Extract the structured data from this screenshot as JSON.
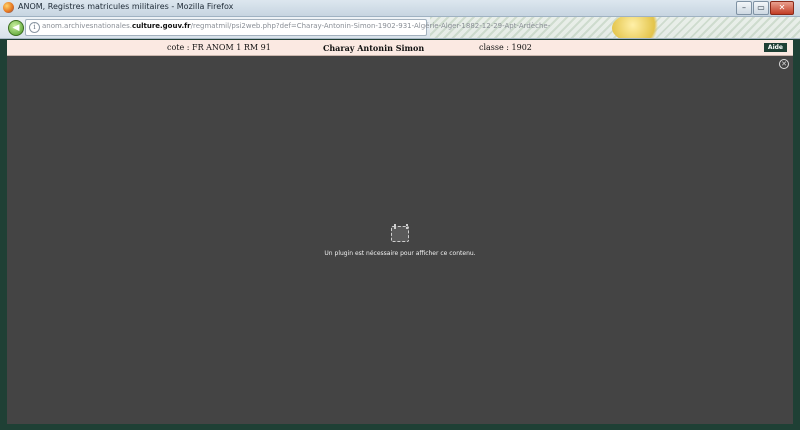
{
  "window": {
    "title": "ANOM, Registres matricules militaires - Mozilla Firefox",
    "controls": {
      "minimize": "–",
      "maximize": "▭",
      "close": "✕"
    }
  },
  "navbar": {
    "back_icon": "back-arrow-icon",
    "url_prefix": "anom.archivesnationales.",
    "url_domain": "culture.gouv.fr",
    "url_suffix": "/regmatmil/psi2web.php?def=Charay-Antonin-Simon-1902-931-Algérie-Alger-1882-12-29-Apt-Ardèche-"
  },
  "viewer": {
    "cote": "cote : FR ANOM 1 RM 91",
    "name": "Charay Antonin Simon",
    "classe": "classe : 1902",
    "help_label": "Aide",
    "plugin_message": "Un plugin est nécessaire pour afficher ce contenu."
  },
  "colors": {
    "frame": "#1f4035",
    "content_bg": "#444444",
    "infobar_bg": "#fbe9e2"
  }
}
